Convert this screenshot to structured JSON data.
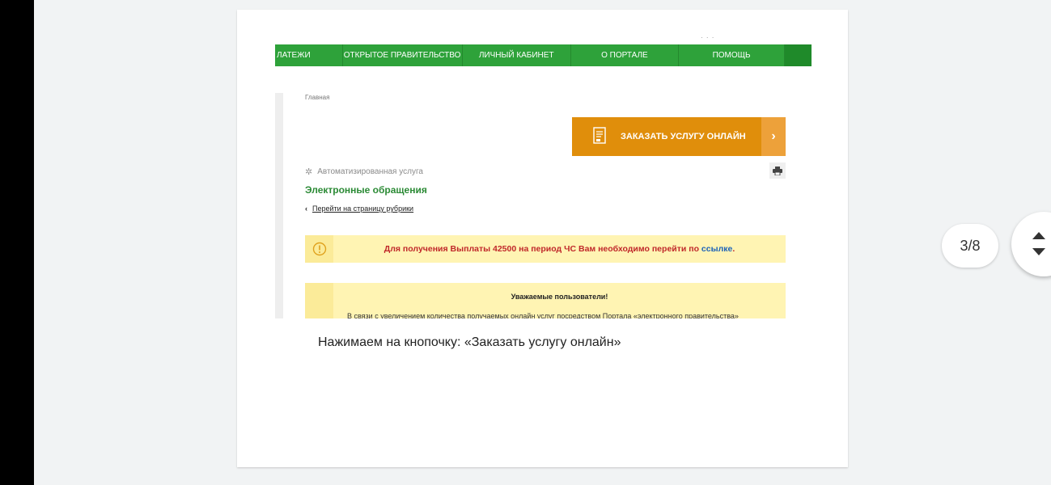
{
  "slide": {
    "cropped_text": "· · ·",
    "nav": {
      "items": [
        "ЛАТЕЖИ",
        "ОТКРЫТОЕ ПРАВИТЕЛЬСТВО",
        "ЛИЧНЫЙ КАБИНЕТ",
        "О ПОРТАЛЕ",
        "ПОМОЩЬ"
      ],
      "color": "#2ea23a"
    },
    "breadcrumb": "Главная",
    "order_button": {
      "label": "ЗАКАЗАТЬ УСЛУГУ ОНЛАЙН",
      "arrow": "›",
      "color": "#e08e0b"
    },
    "service_type": "Автоматизированная услуга",
    "title": "Электронные обращения",
    "back_link": "Перейти на страницу рубрики",
    "alert": {
      "text": "Для получения Выплаты 42500 на период ЧС Вам необходимо перейти по ",
      "link": "ссылке",
      "end": "."
    },
    "notice": {
      "title": "Уважаемые пользователи!",
      "text": "В связи с увеличением количества получаемых онлайн услуг посредством Портала «электронного правительства»"
    },
    "caption": "Нажимаем на кнопочку: «Заказать услугу онлайн»"
  },
  "viewer": {
    "page_counter": "3/8"
  },
  "icons": {
    "order": "document-icon",
    "gear": "gear-icon",
    "print": "printer-icon",
    "info": "info-icon",
    "up": "arrow-up-icon",
    "down": "arrow-down-icon"
  }
}
